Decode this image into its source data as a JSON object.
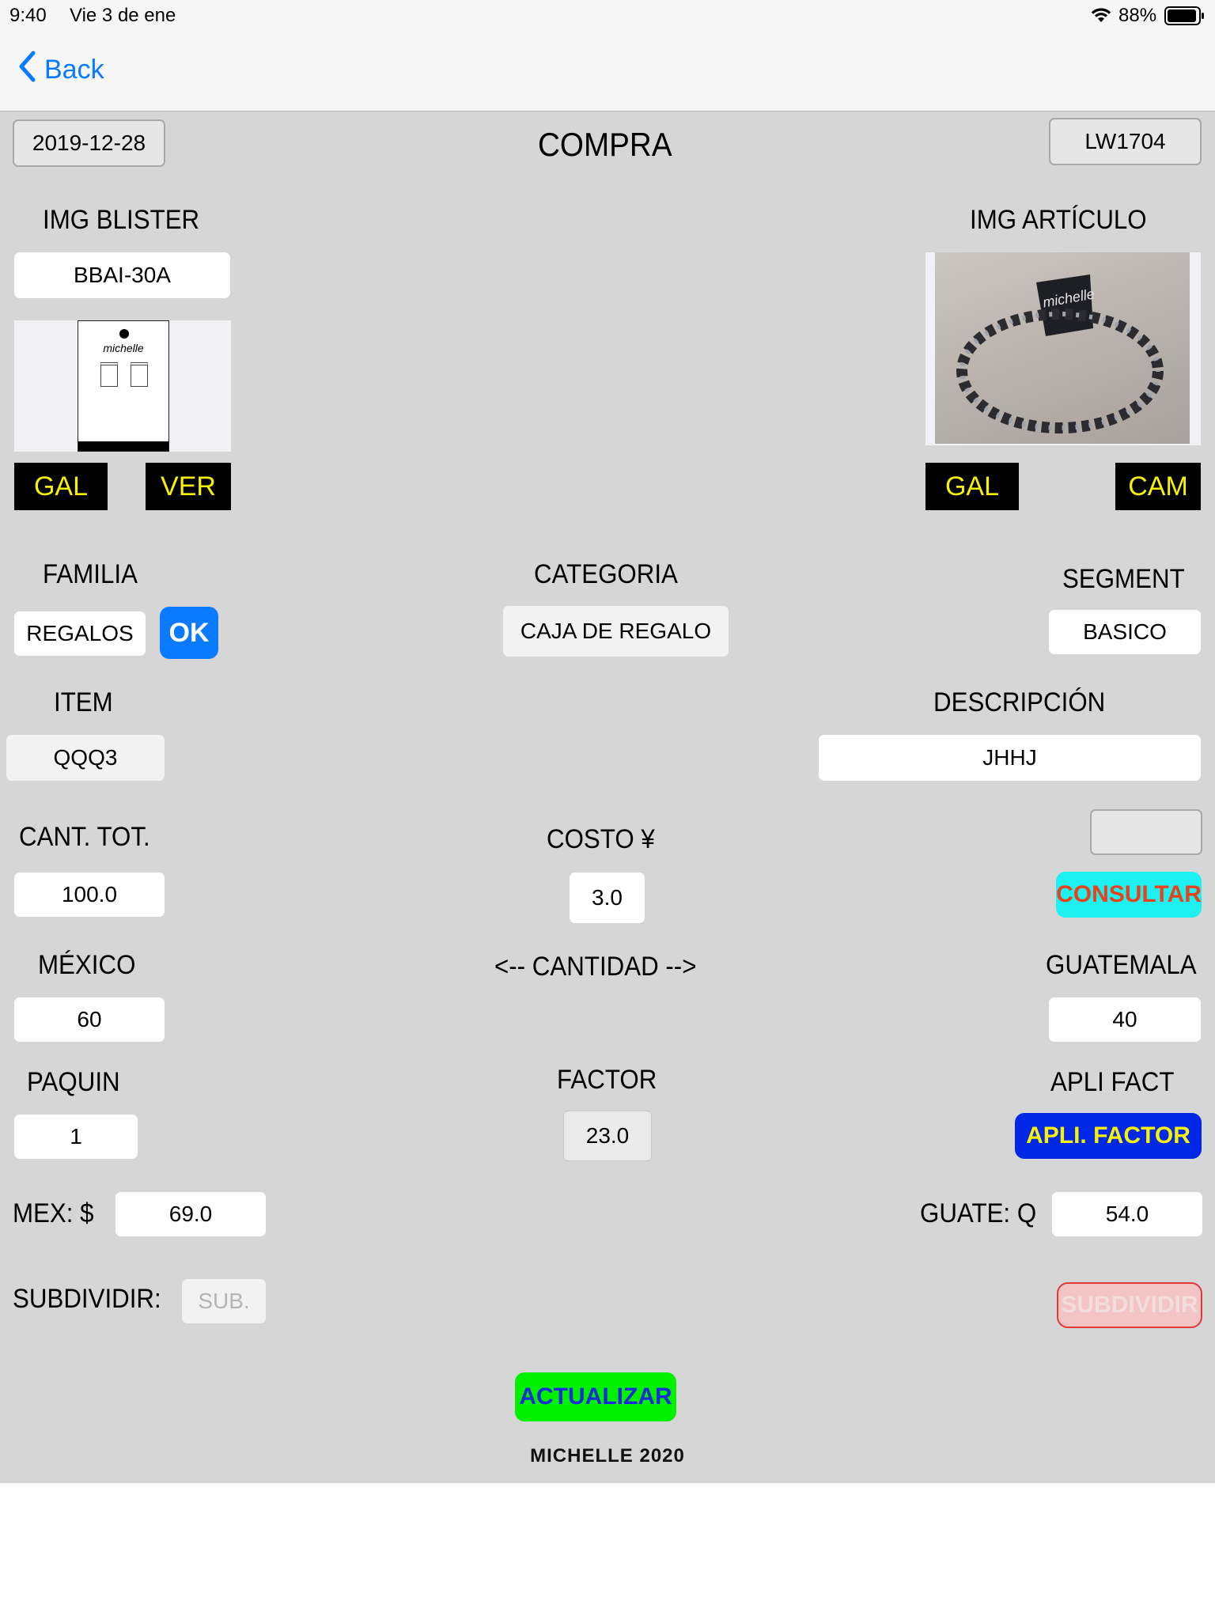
{
  "status_bar": {
    "time": "9:40",
    "date": "Vie 3 de ene",
    "battery": "88%"
  },
  "nav": {
    "back_label": "Back"
  },
  "header": {
    "date": "2019-12-28",
    "title": "COMPRA",
    "code": "LW1704"
  },
  "blister": {
    "title": "IMG BLISTER",
    "code": "BBAI-30A",
    "image_text": "michelle",
    "gal_label": "GAL",
    "ver_label": "VER"
  },
  "articulo": {
    "title": "IMG ARTÍCULO",
    "image_text": "michelle",
    "gal_label": "GAL",
    "cam_label": "CAM"
  },
  "familia": {
    "label": "FAMILIA",
    "value": "REGALOS",
    "ok_label": "OK"
  },
  "categoria": {
    "label": "CATEGORIA",
    "value": "CAJA DE REGALO"
  },
  "segment": {
    "label": "SEGMENT",
    "value": "BASICO"
  },
  "item": {
    "label": "ITEM",
    "value": "QQQ3"
  },
  "descripcion": {
    "label": "DESCRIPCIÓN",
    "value": "JHHJ"
  },
  "cant_tot": {
    "label": "CANT. TOT.",
    "value": "100.0"
  },
  "costo": {
    "label": "COSTO ¥",
    "value": "3.0"
  },
  "consultar": {
    "value": "",
    "button_label": "CONSULTAR"
  },
  "mexico": {
    "label": "MÉXICO",
    "value": "60"
  },
  "cantidad": {
    "label": "<-- CANTIDAD -->"
  },
  "guatemala": {
    "label": "GUATEMALA",
    "value": "40"
  },
  "paquin": {
    "label": "PAQUIN",
    "value": "1"
  },
  "factor": {
    "label": "FACTOR",
    "value": "23.0"
  },
  "apli_fact": {
    "label": "APLI FACT",
    "button_label": "APLI. FACTOR"
  },
  "mex_price": {
    "label": "MEX: $",
    "value": "69.0"
  },
  "guate_price": {
    "label": "GUATE: Q",
    "value": "54.0"
  },
  "subdividir": {
    "label": "SUBDIVIDIR:",
    "placeholder": "SUB.",
    "button_label": "SUBDIVIDIR"
  },
  "actualizar": {
    "button_label": "ACTUALIZAR"
  },
  "footer": {
    "text": "MICHELLE 2020"
  },
  "colors": {
    "ios_blue": "#0a7aff",
    "cyan": "#1ef0f0",
    "navy": "#0028e6",
    "green": "#00f000",
    "yellow": "#f7f300",
    "red_text": "#e8411c"
  }
}
